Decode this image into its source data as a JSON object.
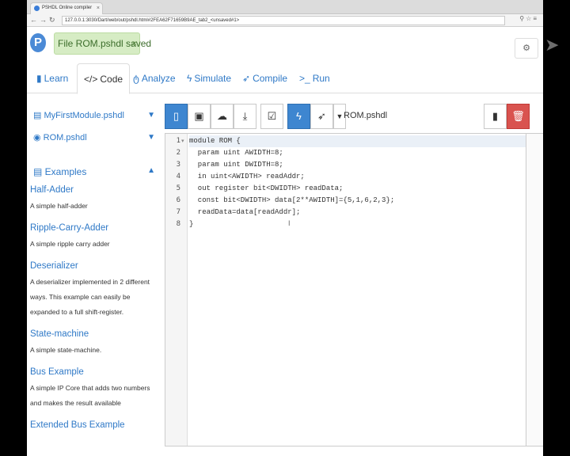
{
  "browser": {
    "tab_title": "PSHDL Online compiler",
    "url": "127.0.0.1:3030/Dart/web/out/pshdl.html#2FEA62F71659B9AE_tab2_<unsaved#1>"
  },
  "app": {
    "logo_letter": "P",
    "saved_message": "File ROM.pshdl saved",
    "close_symbol": "×"
  },
  "tabs": [
    {
      "label": "Learn",
      "icon": "book-icon"
    },
    {
      "label": "Code",
      "icon": "code-icon"
    },
    {
      "label": "Analyze",
      "icon": "stethoscope-icon"
    },
    {
      "label": "Simulate",
      "icon": "bolt-icon"
    },
    {
      "label": "Compile",
      "icon": "rocket-icon"
    },
    {
      "label": "Run",
      "icon": "terminal-icon"
    }
  ],
  "files": [
    {
      "name": "MyFirstModule.pshdl",
      "icon": "file-icon"
    },
    {
      "name": "ROM.pshdl",
      "icon": "eye-icon"
    }
  ],
  "examples": {
    "heading": "Examples",
    "items": [
      {
        "title": "Half-Adder",
        "desc": "A simple half-adder"
      },
      {
        "title": "Ripple-Carry-Adder",
        "desc": "A simple ripple carry adder"
      },
      {
        "title": "Deserializer",
        "desc": "A deserializer implemented in 2 different ways. This example can easily be expanded to a full shift-register."
      },
      {
        "title": "State-machine",
        "desc": "A simple state-machine."
      },
      {
        "title": "Bus Example",
        "desc": "A simple IP Core that adds two numbers and makes the result available"
      },
      {
        "title": "Extended Bus Example",
        "desc": ""
      }
    ]
  },
  "editor": {
    "filename": "ROM.pshdl",
    "fold_marker": "▾",
    "lines": [
      {
        "num": "1",
        "text": "module ROM {"
      },
      {
        "num": "2",
        "text": "  param uint AWIDTH=8;"
      },
      {
        "num": "3",
        "text": "  param uint DWIDTH=8;"
      },
      {
        "num": "4",
        "text": "  in uint<AWIDTH> readAddr;"
      },
      {
        "num": "5",
        "text": "  out register bit<DWIDTH> readData;"
      },
      {
        "num": "6",
        "text": "  const bit<DWIDTH> data[2**AWIDTH]={5,1,6,2,3};"
      },
      {
        "num": "7",
        "text": "  readData=data[readAddr];"
      },
      {
        "num": "8",
        "text": "}"
      }
    ]
  },
  "colors": {
    "link": "#2f79c7",
    "primary": "#3e86d0",
    "danger": "#d9534f",
    "success_bg": "#d6ecc4"
  }
}
